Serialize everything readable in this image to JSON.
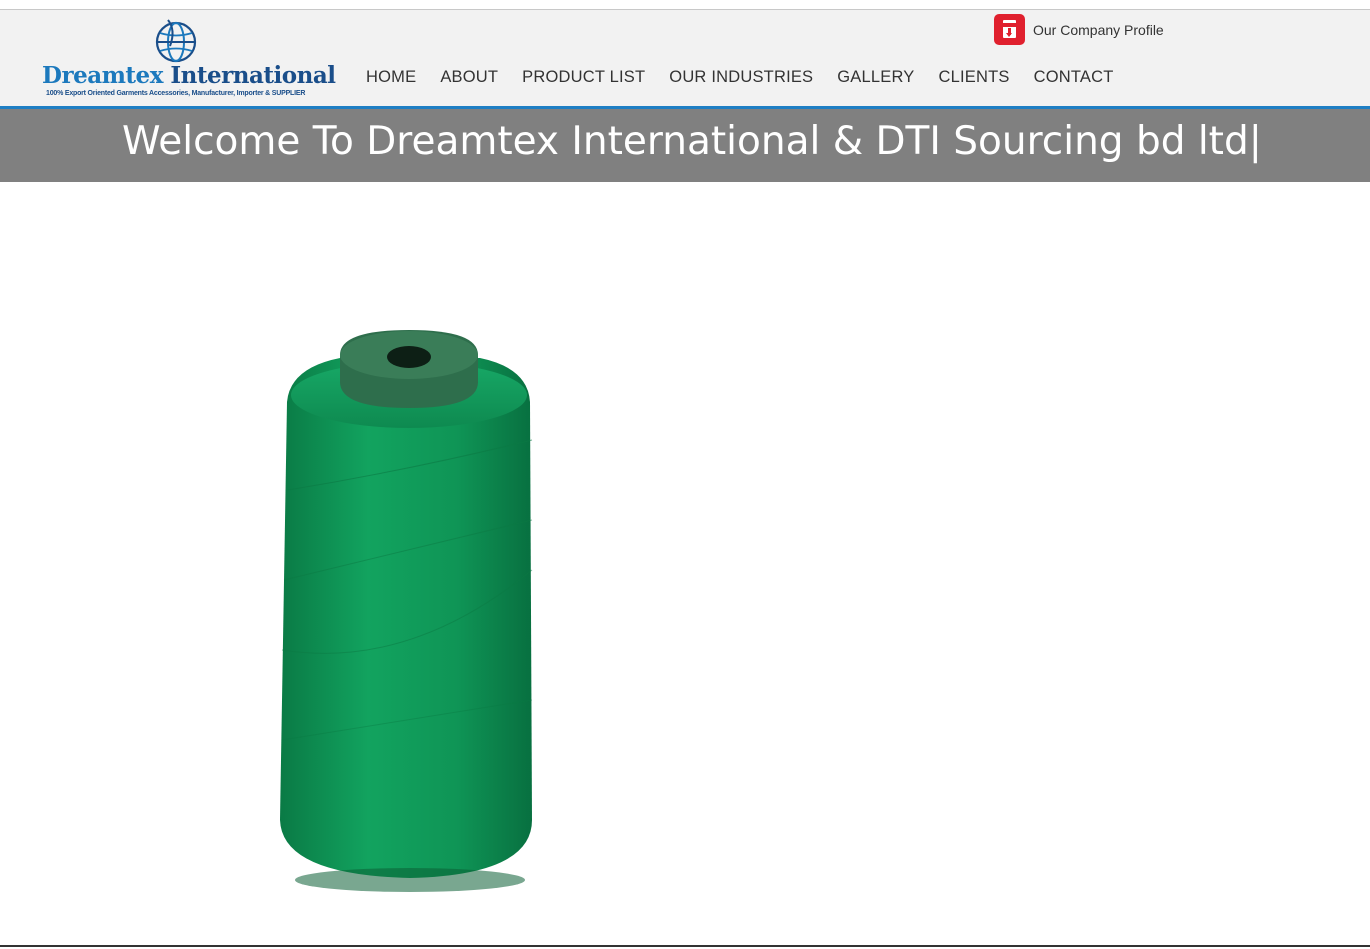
{
  "header": {
    "logo": {
      "name_part1": "Dreamtex",
      "name_part2": " International",
      "tagline": "100% Export Oriented Garments Accessories, Manufacturer, Importer & SUPPLIER"
    },
    "profile_link": {
      "label": "Our Company Profile",
      "icon": "pdf-download-icon"
    },
    "nav": {
      "items": [
        {
          "label": "HOME"
        },
        {
          "label": "ABOUT"
        },
        {
          "label": "PRODUCT LIST"
        },
        {
          "label": "OUR INDUSTRIES"
        },
        {
          "label": "GALLERY"
        },
        {
          "label": "CLIENTS"
        },
        {
          "label": "CONTACT"
        }
      ]
    }
  },
  "banner": {
    "text": "Welcome To Dreamtex International & DTI Sourcing bd ltd|"
  },
  "product_image": {
    "subject": "green thread cone"
  },
  "colors": {
    "accent_blue": "#1f7fc4",
    "banner_gray": "#808080",
    "header_bg": "#f2f2f2",
    "thread_green": "#0f9a5a",
    "pdf_red": "#e0202e"
  }
}
